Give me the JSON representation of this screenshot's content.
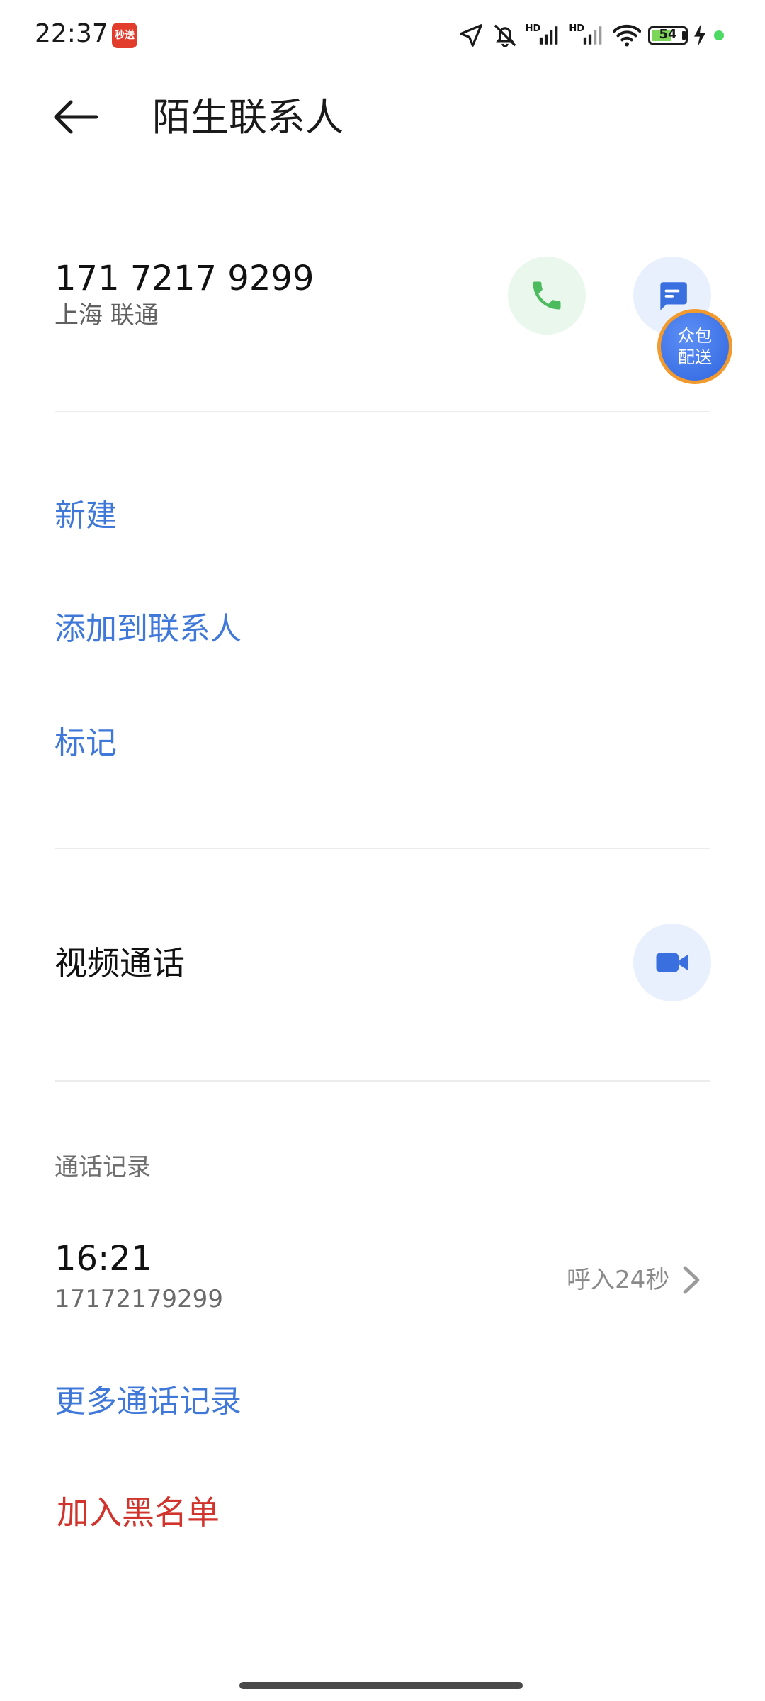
{
  "status_bar": {
    "time": "22:37",
    "app_badge": "秒送",
    "hd1": "HD",
    "hd2": "HD",
    "battery": "54"
  },
  "header": {
    "title": "陌生联系人"
  },
  "contact": {
    "number": "171 7217 9299",
    "location": "上海 联通"
  },
  "float_badge": {
    "line1": "众包",
    "line2": "配送"
  },
  "actions": {
    "new": "新建",
    "add_to_contacts": "添加到联系人",
    "mark": "标记"
  },
  "video_call": {
    "label": "视频通话"
  },
  "call_log": {
    "section_label": "通话记录",
    "entries": [
      {
        "time": "16:21",
        "number": "17172179299",
        "detail": "呼入24秒"
      }
    ],
    "more": "更多通话记录"
  },
  "block": {
    "label": "加入黑名单"
  },
  "colors": {
    "accent": "#3f78d8",
    "danger": "#d0342c",
    "call_green": "#4cbb5e",
    "message_blue": "#3a6fe0"
  }
}
